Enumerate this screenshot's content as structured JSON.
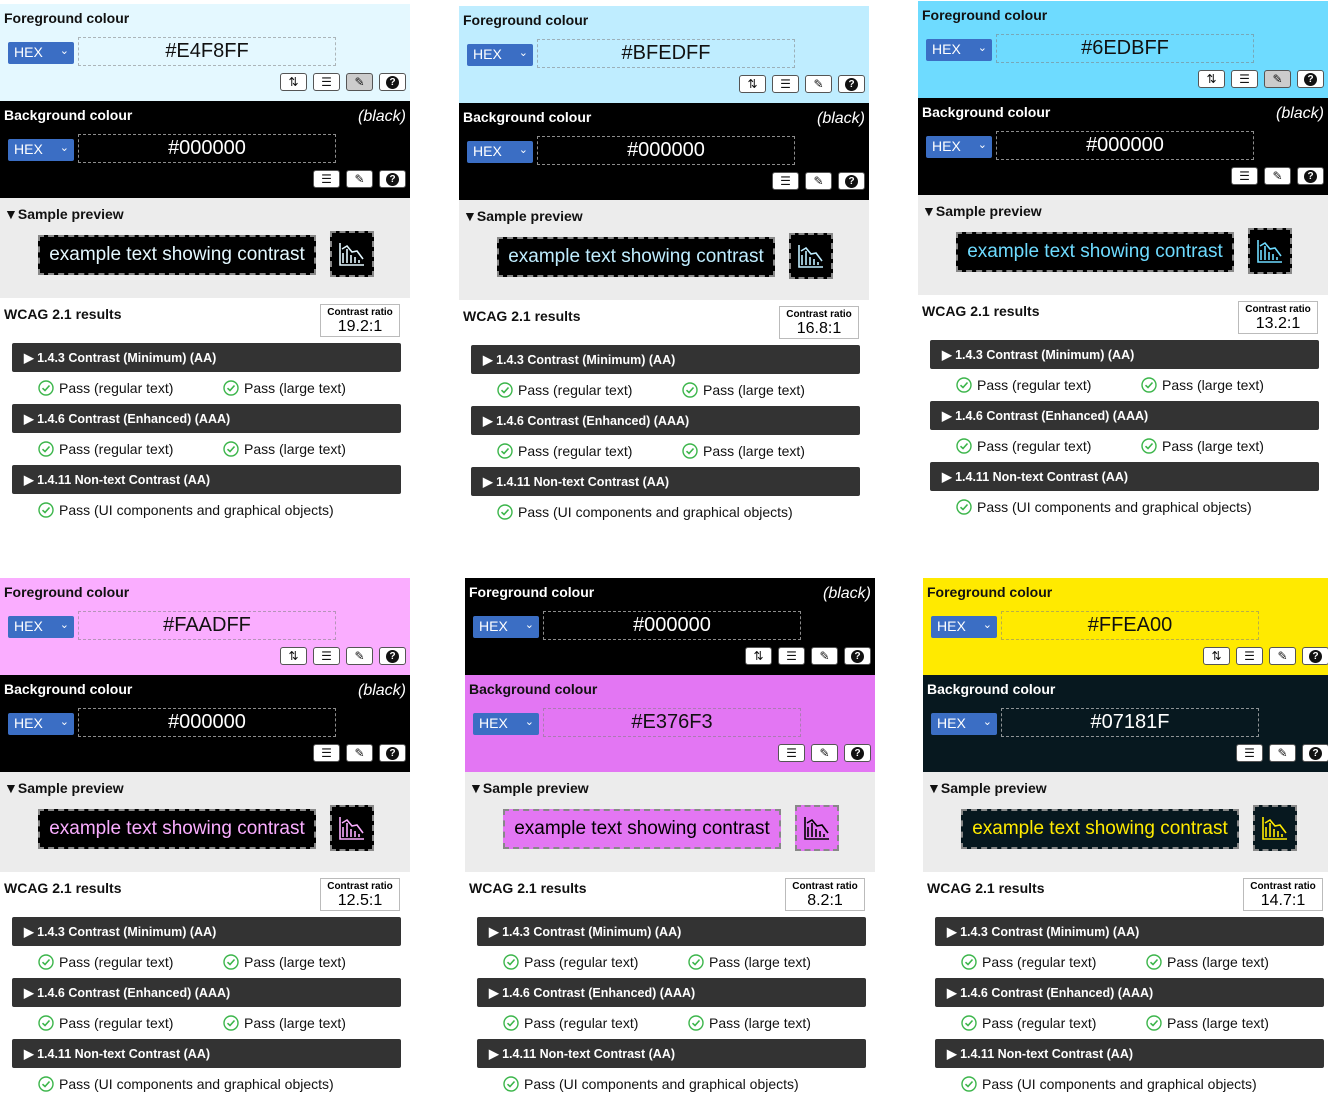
{
  "labels": {
    "foreground_title": "Foreground colour",
    "background_title": "Background colour",
    "format": "HEX",
    "preview_title": "▼Sample preview",
    "sample_text": "example text showing contrast",
    "results_title": "WCAG 2.1 results",
    "ratio_label": "Contrast ratio",
    "crit_143": "▶ 1.4.3 Contrast (Minimum) (AA)",
    "crit_146": "▶ 1.4.6 Contrast (Enhanced) (AAA)",
    "crit_1411": "▶ 1.4.11 Non-text Contrast (AA)",
    "pass_regular": "Pass (regular text)",
    "pass_large": "Pass (large text)",
    "pass_ui": "Pass (UI components and graphical objects)"
  },
  "panels": [
    {
      "fg": "#E4F8FF",
      "bg": "#000000",
      "fg_name": "",
      "bg_name": "(black)",
      "ratio": "19.2:1",
      "fg_swap": true,
      "active_picker": "fg"
    },
    {
      "fg": "#BFEDFF",
      "bg": "#000000",
      "fg_name": "",
      "bg_name": "(black)",
      "ratio": "16.8:1",
      "fg_swap": true,
      "active_picker": ""
    },
    {
      "fg": "#6EDBFF",
      "bg": "#000000",
      "fg_name": "",
      "bg_name": "(black)",
      "ratio": "13.2:1",
      "fg_swap": true,
      "active_picker": "fg"
    },
    {
      "fg": "#FAADFF",
      "bg": "#000000",
      "fg_name": "",
      "bg_name": "(black)",
      "ratio": "12.5:1",
      "fg_swap": true,
      "active_picker": ""
    },
    {
      "fg": "#000000",
      "bg": "#E376F3",
      "fg_name": "(black)",
      "bg_name": "",
      "ratio": "8.2:1",
      "fg_swap": true,
      "active_picker": ""
    },
    {
      "fg": "#FFEA00",
      "bg": "#07181F",
      "fg_name": "",
      "bg_name": "",
      "ratio": "14.7:1",
      "fg_swap": true,
      "active_picker": ""
    }
  ],
  "icons": {
    "swap": "swap-icon",
    "sliders": "sliders-icon",
    "eyedropper": "eyedropper-icon",
    "help": "help-icon",
    "chart": "chart-icon",
    "check": "check-circle-icon",
    "chevron": "chevron-down-icon"
  },
  "colors": {
    "select_blue": "#3B6EC4",
    "criterion_bar": "#333333",
    "preview_bg": "#ECECEC",
    "pass_green": "#3BB54A"
  }
}
